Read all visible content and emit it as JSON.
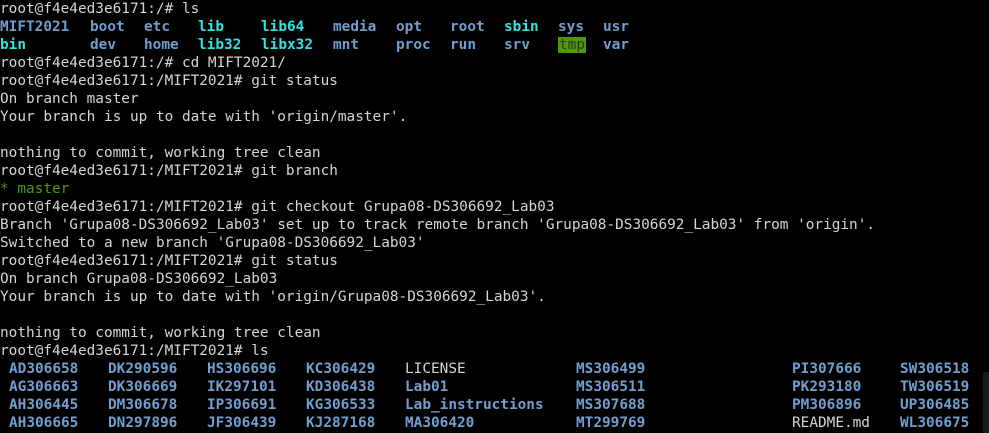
{
  "prompt": "root@f4e4ed3e6171:/MIFT2021#",
  "prompt_root": "root@f4e4ed3e6171:/#",
  "lines": [
    "root@f4e4ed3e6171:/# ls",
    "",
    "",
    "root@f4e4ed3e6171:/# cd MIFT2021/",
    "root@f4e4ed3e6171:/MIFT2021# git status",
    "On branch master",
    "Your branch is up to date with 'origin/master'.",
    "",
    "nothing to commit, working tree clean",
    "root@f4e4ed3e6171:/MIFT2021# git branch",
    "",
    "root@f4e4ed3e6171:/MIFT2021# git checkout Grupa08-DS306692_Lab03",
    "Branch 'Grupa08-DS306692_Lab03' set up to track remote branch 'Grupa08-DS306692_Lab03' from 'origin'.",
    "Switched to a new branch 'Grupa08-DS306692_Lab03'",
    "root@f4e4ed3e6171:/MIFT2021# git status",
    "On branch Grupa08-DS306692_Lab03",
    "Your branch is up to date with 'origin/Grupa08-DS306692_Lab03'.",
    "",
    "nothing to commit, working tree clean",
    "root@f4e4ed3e6171:/MIFT2021# ls"
  ],
  "ls_root": [
    [
      {
        "t": "MIFT2021",
        "c": "dir"
      },
      {
        "t": "boot",
        "c": "dir"
      },
      {
        "t": "etc",
        "c": "dir"
      },
      {
        "t": "lib",
        "c": "cyan"
      },
      {
        "t": "lib64",
        "c": "cyan"
      },
      {
        "t": "media",
        "c": "dir"
      },
      {
        "t": "opt",
        "c": "dir"
      },
      {
        "t": "root",
        "c": "dir"
      },
      {
        "t": "sbin",
        "c": "cyan"
      },
      {
        "t": "sys",
        "c": "dir"
      },
      {
        "t": "usr",
        "c": "dir"
      }
    ],
    [
      {
        "t": "bin",
        "c": "cyan"
      },
      {
        "t": "dev",
        "c": "dir"
      },
      {
        "t": "home",
        "c": "dir"
      },
      {
        "t": "lib32",
        "c": "cyan"
      },
      {
        "t": "libx32",
        "c": "cyan"
      },
      {
        "t": "mnt",
        "c": "dir"
      },
      {
        "t": "proc",
        "c": "dir"
      },
      {
        "t": "run",
        "c": "dir"
      },
      {
        "t": "srv",
        "c": "dir"
      },
      {
        "t": "tmp",
        "c": "tmp"
      },
      {
        "t": "var",
        "c": "dir"
      }
    ]
  ],
  "branch_list": "* master",
  "ls_repo": [
    [
      {
        "t": "AD306658",
        "c": "dir"
      },
      {
        "t": "DK290596",
        "c": "dir"
      },
      {
        "t": "HS306696",
        "c": "dir"
      },
      {
        "t": "KC306429",
        "c": "dir"
      },
      {
        "t": "LICENSE",
        "c": "file"
      },
      {
        "t": "MS306499",
        "c": "dir"
      },
      {
        "t": "PI307666",
        "c": "dir"
      },
      {
        "t": "SW306518",
        "c": "dir"
      }
    ],
    [
      {
        "t": "AG306663",
        "c": "dir"
      },
      {
        "t": "DK306669",
        "c": "dir"
      },
      {
        "t": "IK297101",
        "c": "dir"
      },
      {
        "t": "KD306438",
        "c": "dir"
      },
      {
        "t": "Lab01",
        "c": "dir"
      },
      {
        "t": "MS306511",
        "c": "dir"
      },
      {
        "t": "PK293180",
        "c": "dir"
      },
      {
        "t": "TW306519",
        "c": "dir"
      }
    ],
    [
      {
        "t": "AH306445",
        "c": "dir"
      },
      {
        "t": "DM306678",
        "c": "dir"
      },
      {
        "t": "IP306691",
        "c": "dir"
      },
      {
        "t": "KG306533",
        "c": "dir"
      },
      {
        "t": "Lab_instructions",
        "c": "dir"
      },
      {
        "t": "MS307688",
        "c": "dir"
      },
      {
        "t": "PM306896",
        "c": "dir"
      },
      {
        "t": "UP306485",
        "c": "dir"
      }
    ],
    [
      {
        "t": "AH306665",
        "c": "dir"
      },
      {
        "t": "DN297896",
        "c": "dir"
      },
      {
        "t": "JF306439",
        "c": "dir"
      },
      {
        "t": "KJ287168",
        "c": "dir"
      },
      {
        "t": "MA306420",
        "c": "dir"
      },
      {
        "t": "MT299769",
        "c": "dir"
      },
      {
        "t": "README.md",
        "c": "file"
      },
      {
        "t": "WL306675",
        "c": "dir"
      }
    ]
  ]
}
